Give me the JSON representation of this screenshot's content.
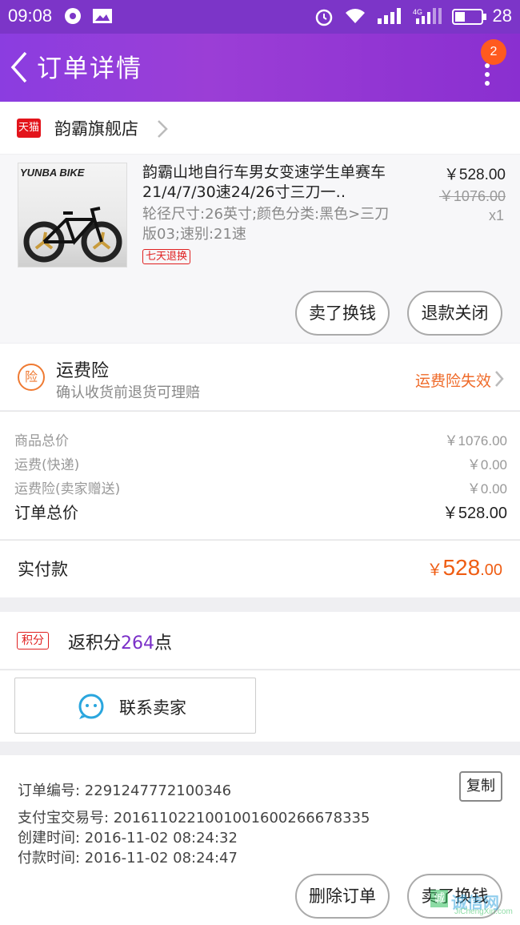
{
  "status_bar": {
    "time": "09:08",
    "battery_level": "28"
  },
  "header": {
    "title": "订单详情",
    "badge_count": "2"
  },
  "shop": {
    "platform_logo_text": "天猫",
    "name": "韵霸旗舰店"
  },
  "product": {
    "thumbnail_brand": "YUNBA BIKE",
    "title": "韵霸山地自行车男女变速学生单赛车21/4/7/30速24/26寸三刀一‥",
    "spec": "轮径尺寸:26英寸;颜色分类:黑色>三刀版03;速别:21速",
    "return_tag": "七天退换",
    "price": "￥528.00",
    "original_price": "￥1076.00",
    "quantity": "x1",
    "sell_button": "卖了换钱",
    "refund_button": "退款关闭"
  },
  "insurance": {
    "icon_text": "险",
    "title": "运费险",
    "subtitle": "确认收货前退货可理赔",
    "status": "运费险失效"
  },
  "costs": {
    "items": [
      {
        "label": "商品总价",
        "value": "￥1076.00"
      },
      {
        "label": "运费(快递)",
        "value": "￥0.00"
      },
      {
        "label": "运费险(卖家赠送)",
        "value": "￥0.00"
      }
    ],
    "total_label": "订单总价",
    "total_value": "￥528.00"
  },
  "paid": {
    "label": "实付款",
    "currency": "￥",
    "integer": "528",
    "decimal": ".00"
  },
  "points": {
    "tag": "积分",
    "prefix": "返积分",
    "amount": "264",
    "suffix": "点"
  },
  "contact": {
    "label": "联系卖家"
  },
  "order_info": {
    "order_no": "订单编号: 2291247772100346",
    "alipay_no": "支付宝交易号: 2016110221001001600266678335",
    "created": "创建时间: 2016-11-02 08:24:32",
    "paid_time": "付款时间: 2016-11-02 08:24:47",
    "copy_button": "复制"
  },
  "actions": {
    "delete_button": "删除订单",
    "sell_button": "卖了换钱"
  },
  "watermark": {
    "icon_text": "诚",
    "text": "诚信网",
    "site": "JiChengXin.com"
  },
  "colors": {
    "header": "#8b3de0",
    "accent_orange": "#ef5d13",
    "points_purple": "#7a2fc8",
    "tmall_red": "#e3141b"
  }
}
